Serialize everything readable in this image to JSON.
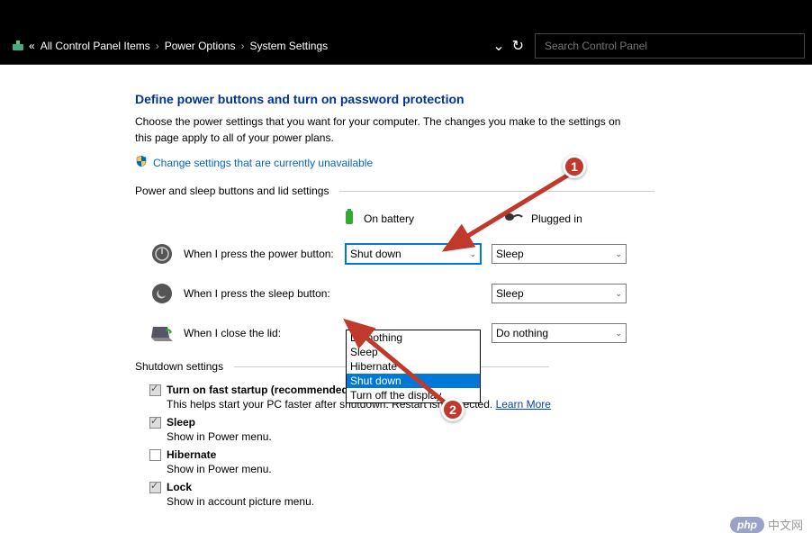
{
  "breadcrumb": {
    "prefix": "«",
    "items": [
      "All Control Panel Items",
      "Power Options",
      "System Settings"
    ]
  },
  "search": {
    "placeholder": "Search Control Panel"
  },
  "page": {
    "title": "Define power buttons and turn on password protection",
    "description": "Choose the power settings that you want for your computer. The changes you make to the settings on this page apply to all of your power plans.",
    "change_link": "Change settings that are currently unavailable"
  },
  "section_buttons_header": "Power and sleep buttons and lid settings",
  "columns": {
    "battery": "On battery",
    "plugged": "Plugged in"
  },
  "rows": [
    {
      "label": "When I press the power button:",
      "battery": "Shut down",
      "plugged": "Sleep"
    },
    {
      "label": "When I press the sleep button:",
      "battery": "",
      "plugged": "Sleep"
    },
    {
      "label": "When I close the lid:",
      "battery": "",
      "plugged": "Do nothing"
    }
  ],
  "dropdown_options": [
    "Do nothing",
    "Sleep",
    "Hibernate",
    "Shut down",
    "Turn off the display"
  ],
  "dropdown_selected": "Shut down",
  "shutdown_header": "Shutdown settings",
  "shutdown_items": [
    {
      "label": "Turn on fast startup (recommended)",
      "desc_pre": "This helps start your PC faster after shutdown. Restart isn't affected. ",
      "link": "Learn More",
      "checked": true
    },
    {
      "label": "Sleep",
      "desc_pre": "Show in Power menu.",
      "link": "",
      "checked": true
    },
    {
      "label": "Hibernate",
      "desc_pre": "Show in Power menu.",
      "link": "",
      "checked": false
    },
    {
      "label": "Lock",
      "desc_pre": "Show in account picture menu.",
      "link": "",
      "checked": true
    }
  ],
  "annotations": {
    "badge1": "1",
    "badge2": "2"
  },
  "watermark": {
    "logo": "php",
    "text": "中文网"
  }
}
